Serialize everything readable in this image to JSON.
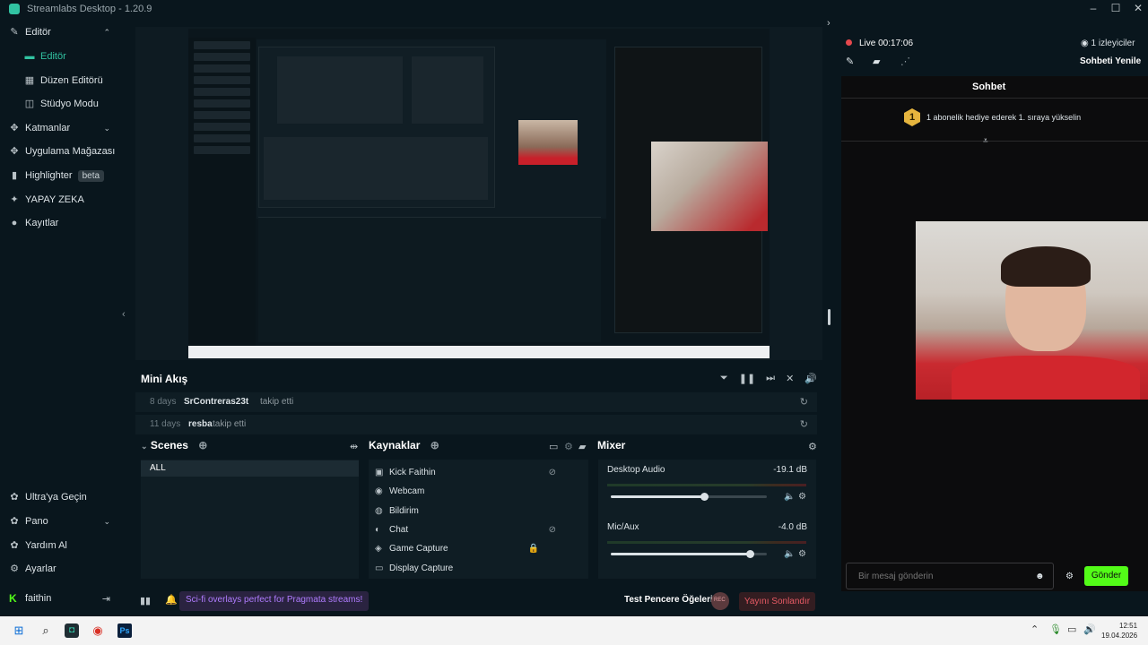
{
  "window": {
    "title": "Streamlabs Desktop - 1.20.9",
    "controls": [
      "–",
      "☐",
      "✕"
    ]
  },
  "sidebar": {
    "top": [
      {
        "label": "Editör",
        "icon": "pencil-icon",
        "chev": "⌃"
      },
      {
        "label": "Editör",
        "icon": "editor-icon",
        "active": true
      },
      {
        "label": "Düzen Editörü",
        "icon": "layout-icon"
      },
      {
        "label": "Stüdyo Modu",
        "icon": "studio-icon"
      },
      {
        "label": "Katmanlar",
        "icon": "layers-icon",
        "chev": "⌄"
      },
      {
        "label": "Uygulama Mağazası",
        "icon": "store-icon",
        "chev": "⌄"
      },
      {
        "label": "Highlighter",
        "icon": "highlighter-icon",
        "badge": "beta"
      },
      {
        "label": "YAPAY ZEKA",
        "icon": "ai-icon"
      },
      {
        "label": "Kayıtlar",
        "icon": "recordings-icon"
      }
    ],
    "bottom": [
      {
        "label": "Ultra'ya Geçin",
        "icon": "ultra-icon"
      },
      {
        "label": "Pano",
        "icon": "dashboard-icon",
        "chev": "⌄"
      },
      {
        "label": "Yardım Al",
        "icon": "help-icon"
      },
      {
        "label": "Ayarlar",
        "icon": "settings-icon"
      }
    ],
    "user": {
      "name": "faithin",
      "logout": "⇥"
    }
  },
  "mini_feed": {
    "title": "Mini Akış",
    "rows": [
      {
        "days": "8 days",
        "user": "SrContreras23t",
        "action": "takip etti"
      },
      {
        "days": "11 days",
        "user": "resba",
        "action": "takip etti"
      }
    ]
  },
  "scenes": {
    "title": "Scenes",
    "items": [
      "ALL"
    ]
  },
  "sources": {
    "title": "Kaynaklar",
    "items": [
      {
        "label": "Kick Faithin",
        "icon": "image-icon",
        "tail": "⊘"
      },
      {
        "label": "Webcam",
        "icon": "camera-icon",
        "tail": ""
      },
      {
        "label": "Bildirim",
        "icon": "globe-icon",
        "tail": ""
      },
      {
        "label": "Chat",
        "icon": "chat-icon",
        "tail": "⊘"
      },
      {
        "label": "Game Capture",
        "icon": "gamepad-icon",
        "tail": "🔒"
      },
      {
        "label": "Display Capture",
        "icon": "monitor-icon",
        "tail": ""
      }
    ]
  },
  "mixer": {
    "title": "Mixer",
    "channels": [
      {
        "name": "Desktop Audio",
        "db": "-19.1 dB",
        "level": 0.6
      },
      {
        "name": "Mic/Aux",
        "db": "-4.0 dB",
        "level": 0.89
      }
    ]
  },
  "footer": {
    "banner": "Sci-fi overlays perfect for Pragmata streams!",
    "test_label": "Test Pencere Öğeleri",
    "rec_label": "REC",
    "stop_label": "Yayını Sonlandır"
  },
  "right": {
    "live_label": "Live 00:17:06",
    "viewers": "1 izleyiciler",
    "refresh": "Sohbeti Yenile",
    "chat_title": "Sohbet",
    "goal_rank": "1",
    "goal_text": "1 abonelik hediye ederek 1. sıraya yükselin",
    "input_placeholder": "Bir mesaj gönderin",
    "send_label": "Gönder"
  },
  "clock": {
    "time": "12:51",
    "date": "19.04.2026"
  },
  "colors": {
    "accent": "#31c3a2",
    "kick_green": "#53fc18",
    "live_red": "#e5484d",
    "stop_red": "#e65a64",
    "banner_purple": "#b07cff"
  }
}
